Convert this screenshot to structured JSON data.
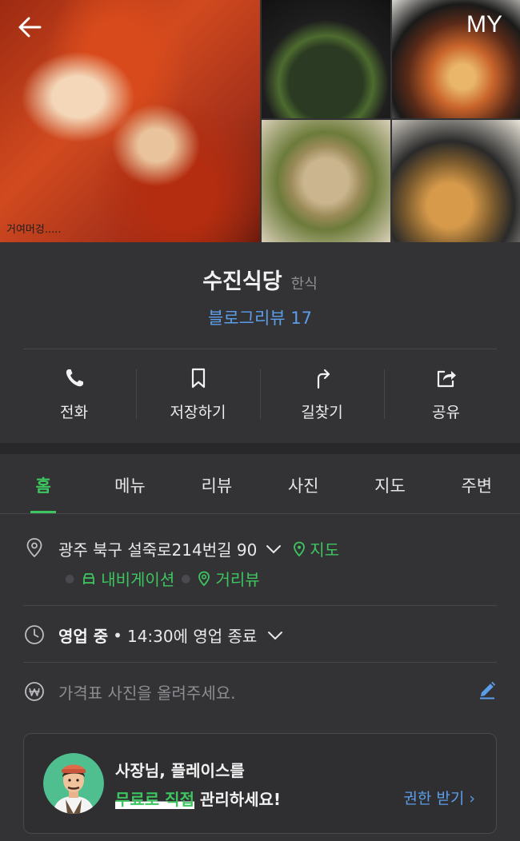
{
  "header": {
    "my_label": "MY",
    "photo_caption": "거여머겅....."
  },
  "place": {
    "name": "수진식당",
    "category": "한식",
    "reviews": "블로그리뷰 17"
  },
  "actions": [
    {
      "label": "전화",
      "icon": "phone-icon"
    },
    {
      "label": "저장하기",
      "icon": "bookmark-icon"
    },
    {
      "label": "길찾기",
      "icon": "directions-icon"
    },
    {
      "label": "공유",
      "icon": "share-icon"
    }
  ],
  "tabs": [
    {
      "label": "홈",
      "active": true
    },
    {
      "label": "메뉴"
    },
    {
      "label": "리뷰"
    },
    {
      "label": "사진"
    },
    {
      "label": "지도"
    },
    {
      "label": "주변"
    }
  ],
  "info": {
    "address": "광주 북구 설죽로214번길 90",
    "map_link": "지도",
    "navigation_link": "내비게이션",
    "street_view_link": "거리뷰",
    "status": "영업 중",
    "hours": "14:30에 영업 종료",
    "price_placeholder": "가격표 사진을 올려주세요."
  },
  "owner_card": {
    "line1": "사장님, 플레이스를",
    "highlight": "무료로 직접",
    "line2_rest": " 관리하세요!",
    "permission_link": "권한 받기 ›"
  },
  "colors": {
    "background": "#333336",
    "accent_green": "#3dc65f",
    "link_blue": "#5c9dea"
  }
}
